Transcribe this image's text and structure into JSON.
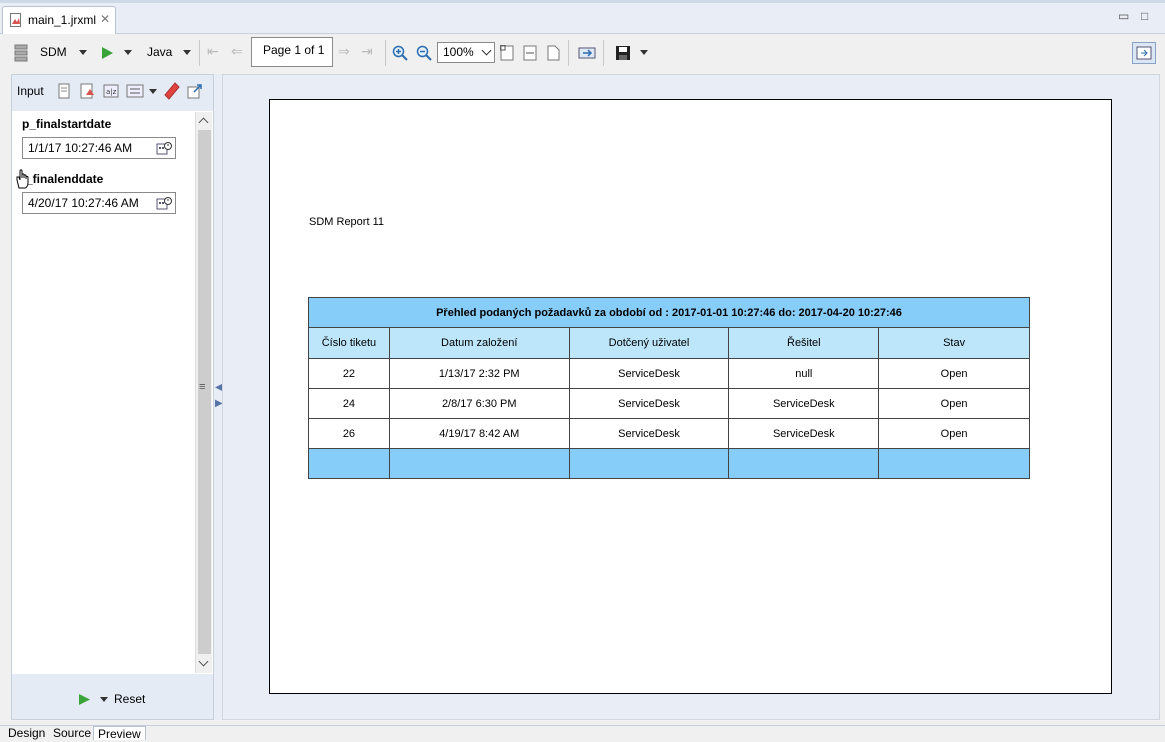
{
  "editor": {
    "tab_label": "main_1.jrxml"
  },
  "toolbar": {
    "datasource": "SDM",
    "language": "Java",
    "page_indicator": "Page 1 of 1",
    "zoom": "100%"
  },
  "input_panel": {
    "header_label": "Input",
    "params": [
      {
        "name": "p_finalstartdate",
        "value": "1/1/17 10:27:46 AM"
      },
      {
        "name": "_finalenddate",
        "value": "4/20/17 10:27:46 AM"
      }
    ],
    "reset_label": "Reset"
  },
  "report": {
    "title": "SDM Report 11",
    "caption": "Přehled podaných požadavků za období od : 2017-01-01 10:27:46 do: 2017-04-20 10:27:46",
    "columns": [
      "Číslo tiketu",
      "Datum založení",
      "Dotčený uživatel",
      "Řešitel",
      "Stav"
    ],
    "rows": [
      [
        "22",
        "1/13/17 2:32 PM",
        "ServiceDesk",
        "null",
        "Open"
      ],
      [
        "24",
        "2/8/17 6:30 PM",
        "ServiceDesk",
        "ServiceDesk",
        "Open"
      ],
      [
        "26",
        "4/19/17 8:42 AM",
        "ServiceDesk",
        "ServiceDesk",
        "Open"
      ]
    ]
  },
  "bottom_tabs": [
    "Design",
    "Source",
    "Preview"
  ],
  "colors": {
    "caption_bg": "#87cdfa",
    "header_bg": "#bde6fb",
    "run_green": "#3aa33a"
  }
}
